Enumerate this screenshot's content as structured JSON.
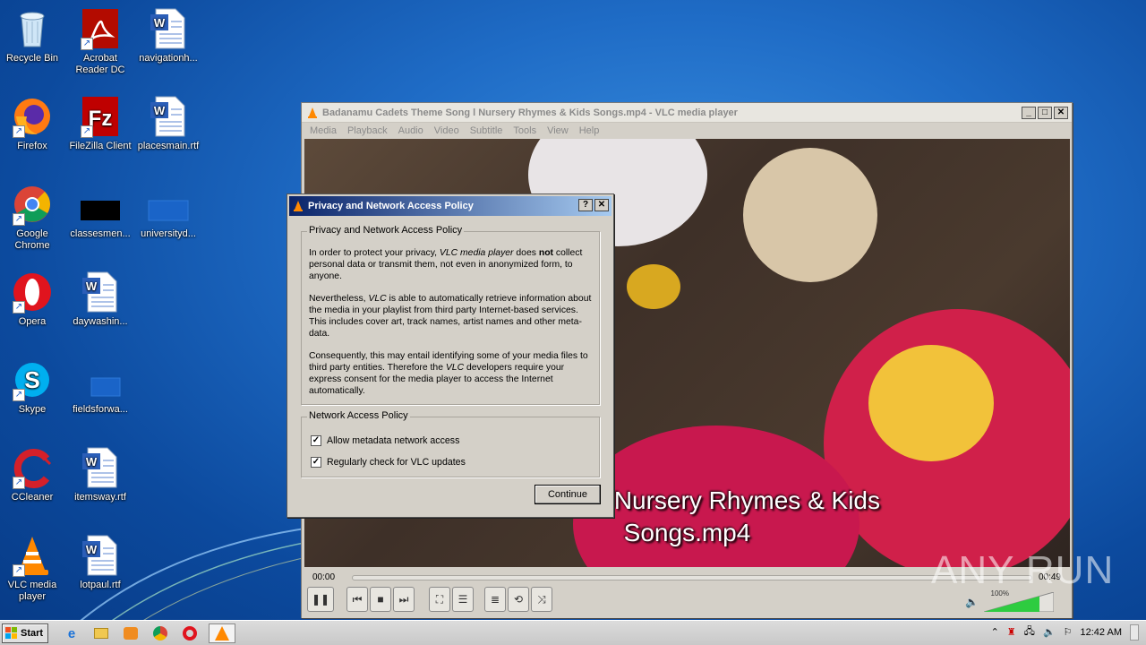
{
  "desktop_icons": [
    {
      "label": "Recycle Bin",
      "icon": "recycle-bin-icon"
    },
    {
      "label": "Acrobat Reader DC",
      "icon": "acrobat-icon"
    },
    {
      "label": "navigationh...",
      "icon": "word-doc-icon"
    },
    {
      "label": "Firefox",
      "icon": "firefox-icon"
    },
    {
      "label": "FileZilla Client",
      "icon": "filezilla-icon"
    },
    {
      "label": "placesmain.rtf",
      "icon": "word-doc-icon"
    },
    {
      "label": "Google Chrome",
      "icon": "chrome-icon"
    },
    {
      "label": "classesmen...",
      "icon": "black-file-icon"
    },
    {
      "label": "universityd...",
      "icon": "blank-file-icon"
    },
    {
      "label": "Opera",
      "icon": "opera-icon"
    },
    {
      "label": "daywashin...",
      "icon": "word-doc-icon"
    },
    {
      "label": "Skype",
      "icon": "skype-icon"
    },
    {
      "label": "fieldsforwa...",
      "icon": "blank-file-icon"
    },
    {
      "label": "CCleaner",
      "icon": "ccleaner-icon"
    },
    {
      "label": "itemsway.rtf",
      "icon": "word-doc-icon"
    },
    {
      "label": "VLC media player",
      "icon": "vlc-icon"
    },
    {
      "label": "lotpaul.rtf",
      "icon": "word-doc-icon"
    }
  ],
  "vlc": {
    "title": "Badanamu Cadets Theme Song l Nursery Rhymes & Kids Songs.mp4 - VLC media player",
    "menu": [
      "Media",
      "Playback",
      "Audio",
      "Video",
      "Subtitle",
      "Tools",
      "View",
      "Help"
    ],
    "subtitle_line1": "me Song l Nursery Rhymes & Kids",
    "subtitle_line2": "Songs.mp4",
    "time_elapsed": "00:00",
    "time_total": "00:49",
    "volume": "100%"
  },
  "dialog": {
    "title": "Privacy and Network Access Policy",
    "help_btn": "?",
    "close_btn": "✕",
    "group1_legend": "Privacy and Network Access Policy",
    "p1_a": "In order to protect your privacy,",
    "p1_em": "VLC media player",
    "p1_b": "does",
    "p1_strong": "not",
    "p1_c": "collect personal data or transmit them, not even in anonymized form, to anyone.",
    "p2_a": "Nevertheless,",
    "p2_em": "VLC",
    "p2_b": "is able to automatically retrieve information about the media in your playlist from third party Internet-based services. This includes cover art, track names, artist names and other meta-data.",
    "p3_a": "Consequently, this may entail identifying some of your media files to third party entities. Therefore the",
    "p3_em": "VLC",
    "p3_b": "developers require your express consent for the media player to access the Internet automatically.",
    "group2_legend": "Network Access Policy",
    "cb1": "Allow metadata network access",
    "cb2": "Regularly check for VLC updates",
    "continue": "Continue"
  },
  "taskbar": {
    "start": "Start",
    "clock": "12:42 AM"
  },
  "watermark": "ANY RUN"
}
